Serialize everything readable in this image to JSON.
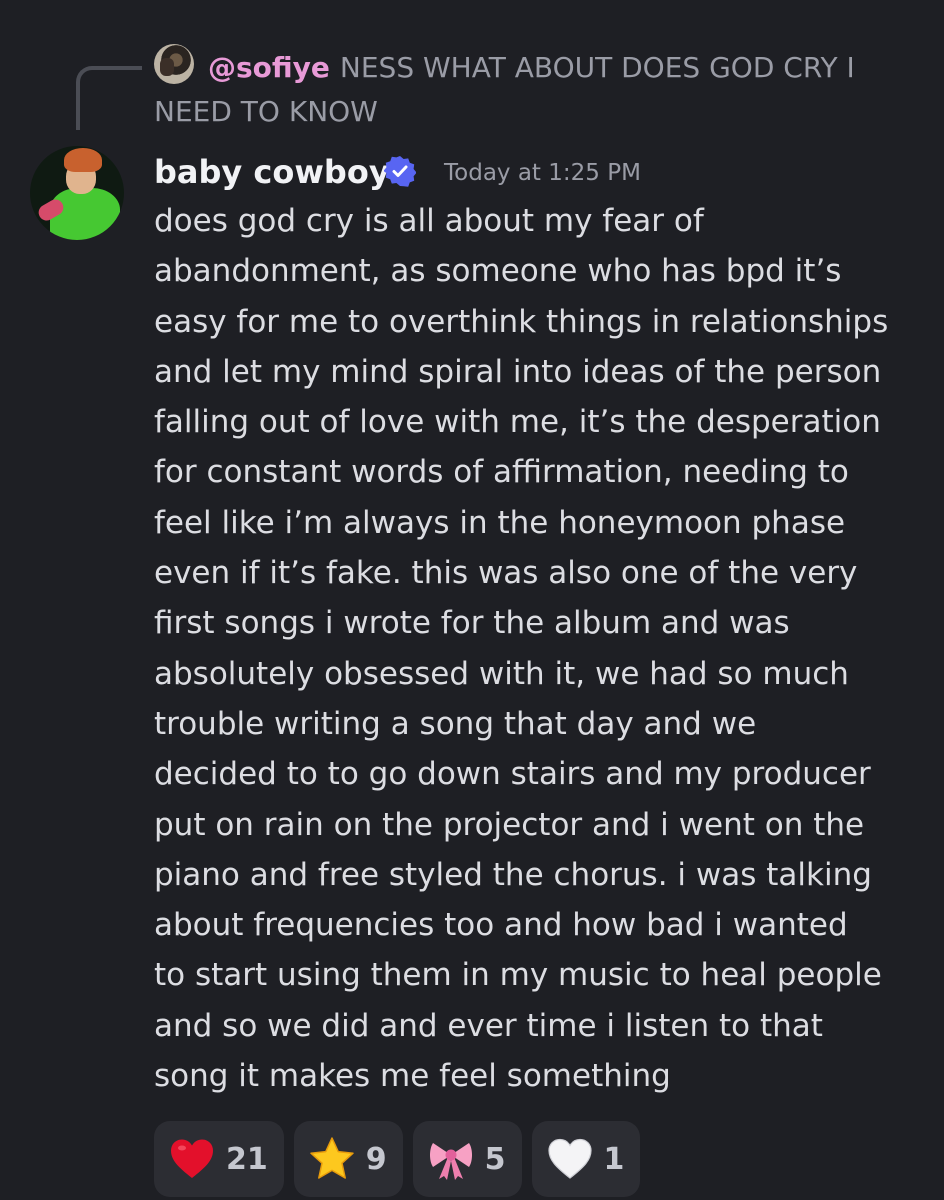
{
  "reply": {
    "username": "@sofiye",
    "text": "NESS WHAT ABOUT DOES GOD CRY I NEED TO KNOW"
  },
  "message": {
    "author": "baby cowboy",
    "verified_icon": "verified-badge-icon",
    "timestamp": "Today at 1:25 PM",
    "lines": [
      "does god cry is all about my fear of",
      "abandonment, as someone who has bpd it’s",
      "easy for me to overthink things in relationships",
      "and let my mind spiral into ideas of the person",
      "falling out of love with me, it’s the desperation",
      "for constant words of affirmation, needing to",
      "feel like i’m always in the honeymoon phase",
      "even if it’s fake. this was also one of the very",
      "first songs i wrote for the album and was",
      "absolutely obsessed with it, we had so much",
      "trouble writing a song that day and we",
      "decided to to go down stairs and my producer",
      "put on rain on the projector and i went on the",
      "piano and free styled the chorus. i was talking",
      "about frequencies too and how bad i wanted",
      "to start using them in my music to heal people",
      "and so we did and ever time i listen to that",
      "song it makes me feel something"
    ]
  },
  "reactions": [
    {
      "emoji": "red-heart-icon",
      "count": "21"
    },
    {
      "emoji": "star-icon",
      "count": "9"
    },
    {
      "emoji": "pink-bow-icon",
      "count": "5"
    },
    {
      "emoji": "white-heart-icon",
      "count": "1"
    }
  ],
  "colors": {
    "background": "#1e1f24",
    "reply_username": "#e89ad7",
    "verified": "#5865f2",
    "reaction_bg": "#2c2d33"
  }
}
